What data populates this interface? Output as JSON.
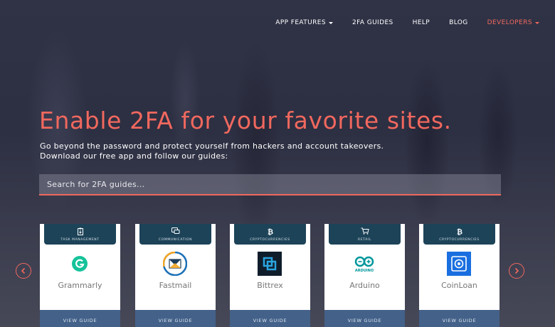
{
  "nav": {
    "items": [
      {
        "label": "APP FEATURES",
        "dropdown": true,
        "accent": false
      },
      {
        "label": "2FA GUIDES",
        "dropdown": false,
        "accent": false
      },
      {
        "label": "HELP",
        "dropdown": false,
        "accent": false
      },
      {
        "label": "BLOG",
        "dropdown": false,
        "accent": false
      },
      {
        "label": "DEVELOPERS",
        "dropdown": true,
        "accent": true
      }
    ]
  },
  "hero": {
    "title": "Enable 2FA for your favorite sites.",
    "subtitle_line1": "Go beyond the password and protect yourself from hackers and account takeovers.",
    "subtitle_line2": "Download our free app and follow our guides:"
  },
  "search": {
    "placeholder": "Search for 2FA guides..."
  },
  "carousel": {
    "prev_icon": "chevron-left-icon",
    "next_icon": "chevron-right-icon",
    "cards": [
      {
        "category": "TASK MANAGEMENT",
        "category_icon": "clipboard-icon",
        "name": "Grammarly",
        "logo": "grammarly-logo",
        "button": "VIEW GUIDE"
      },
      {
        "category": "COMMUNICATION",
        "category_icon": "chat-icon",
        "name": "Fastmail",
        "logo": "fastmail-logo",
        "button": "VIEW GUIDE"
      },
      {
        "category": "CRYPTOCURRENCIES",
        "category_icon": "bitcoin-icon",
        "name": "Bittrex",
        "logo": "bittrex-logo",
        "button": "VIEW GUIDE"
      },
      {
        "category": "RETAIL",
        "category_icon": "cart-icon",
        "name": "Arduino",
        "logo": "arduino-logo",
        "logo_text": "ARDUINO",
        "button": "VIEW GUIDE"
      },
      {
        "category": "CRYPTOCURRENCIES",
        "category_icon": "bitcoin-icon",
        "name": "CoinLoan",
        "logo": "coinloan-logo",
        "button": "VIEW GUIDE"
      }
    ]
  },
  "colors": {
    "accent": "#f1685e",
    "card_tab": "#1d4358",
    "card_button": "#436189"
  }
}
